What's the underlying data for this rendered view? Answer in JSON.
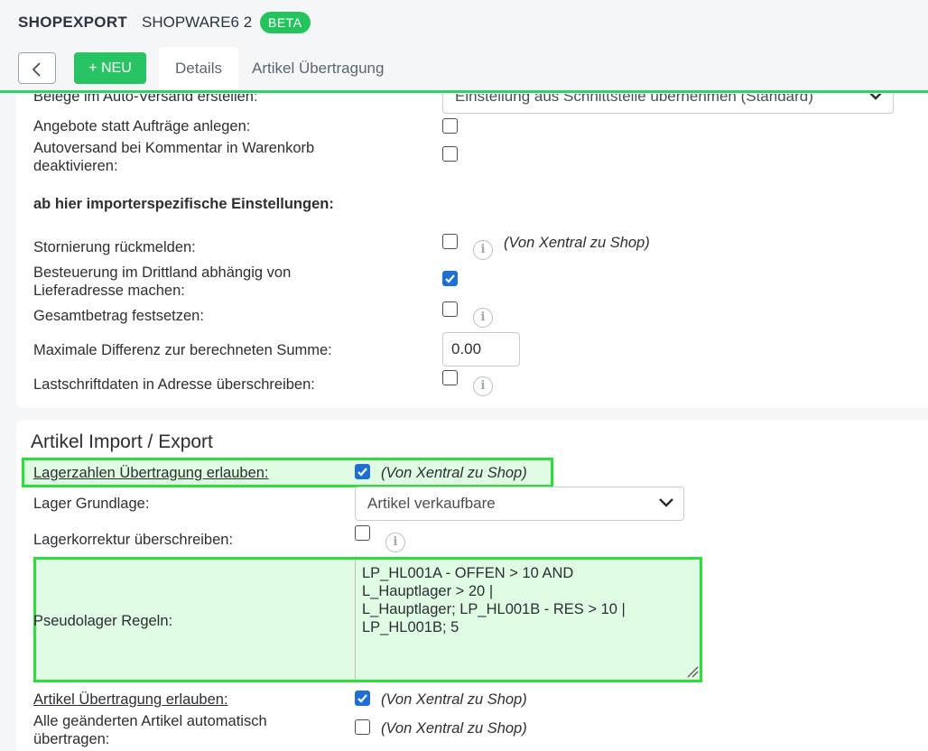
{
  "header": {
    "brand": "SHOPEXPORT",
    "module": "SHOPWARE6 2",
    "badge": "BETA",
    "new_button": "+ NEU",
    "tabs": [
      "Details",
      "Artikel Übertragung"
    ]
  },
  "order_settings": {
    "auto_versand_label": "Belege im Auto-Versand erstellen:",
    "auto_versand_value": "Einstellung aus Schnittstelle übernehmen (Standard)",
    "angebote_label": "Angebote statt Aufträge anlegen:",
    "angebote_checked": false,
    "autoversand_kommentar_label_1": "Autoversand bei Kommentar in Warenkorb",
    "autoversand_kommentar_label_2": "deaktivieren:",
    "autoversand_kommentar_checked": false,
    "importer_heading": "ab hier importerspezifische Einstellungen:",
    "stornierung_label": "Stornierung rückmelden:",
    "stornierung_checked": false,
    "stornierung_hint": "(Von Xentral zu Shop)",
    "besteuerung_label_1": "Besteuerung im Drittland abhängig von",
    "besteuerung_label_2": "Lieferadresse machen:",
    "besteuerung_checked": true,
    "gesamtbetrag_label": "Gesamtbetrag festsetzen:",
    "gesamtbetrag_checked": false,
    "max_differenz_label": "Maximale Differenz zur berechneten Summe:",
    "max_differenz_value": "0.00",
    "lastschrift_label": "Lastschriftdaten in Adresse überschreiben:",
    "lastschrift_checked": false
  },
  "article_section": {
    "title": "Artikel Import / Export",
    "lagerzahlen_label": "Lagerzahlen Übertragung erlauben:",
    "lagerzahlen_checked": true,
    "lagerzahlen_hint": "(Von Xentral zu Shop)",
    "lager_grundlage_label": "Lager Grundlage:",
    "lager_grundlage_value": "Artikel verkaufbare",
    "lagerkorrektur_label": "Lagerkorrektur überschreiben:",
    "lagerkorrektur_checked": false,
    "pseudolager_label": "Pseudolager Regeln:",
    "pseudolager_value": "LP_HL001A - OFFEN > 10 AND\nL_Hauptlager > 20 |\nL_Hauptlager; LP_HL001B - RES > 10 |\nLP_HL001B; 5",
    "artikel_uebertragung_label": "Artikel Übertragung erlauben:",
    "artikel_uebertragung_checked": true,
    "artikel_uebertragung_hint": "(Von Xentral zu Shop)",
    "alle_geaendert_label_1": "Alle geänderten Artikel automatisch",
    "alle_geaendert_label_2": "übertragen:",
    "alle_geaendert_checked": false,
    "alle_geaendert_hint": "(Von Xentral zu Shop)"
  },
  "colors": {
    "accent_green": "#28c463",
    "highlight_border": "#29e038",
    "highlight_fill": "#e0fbe3",
    "checkbox_blue": "#1f6fd1"
  },
  "icons": [
    "chevron-left-icon",
    "chevron-down-icon",
    "info-icon",
    "check-icon",
    "resize-grip-icon"
  ]
}
